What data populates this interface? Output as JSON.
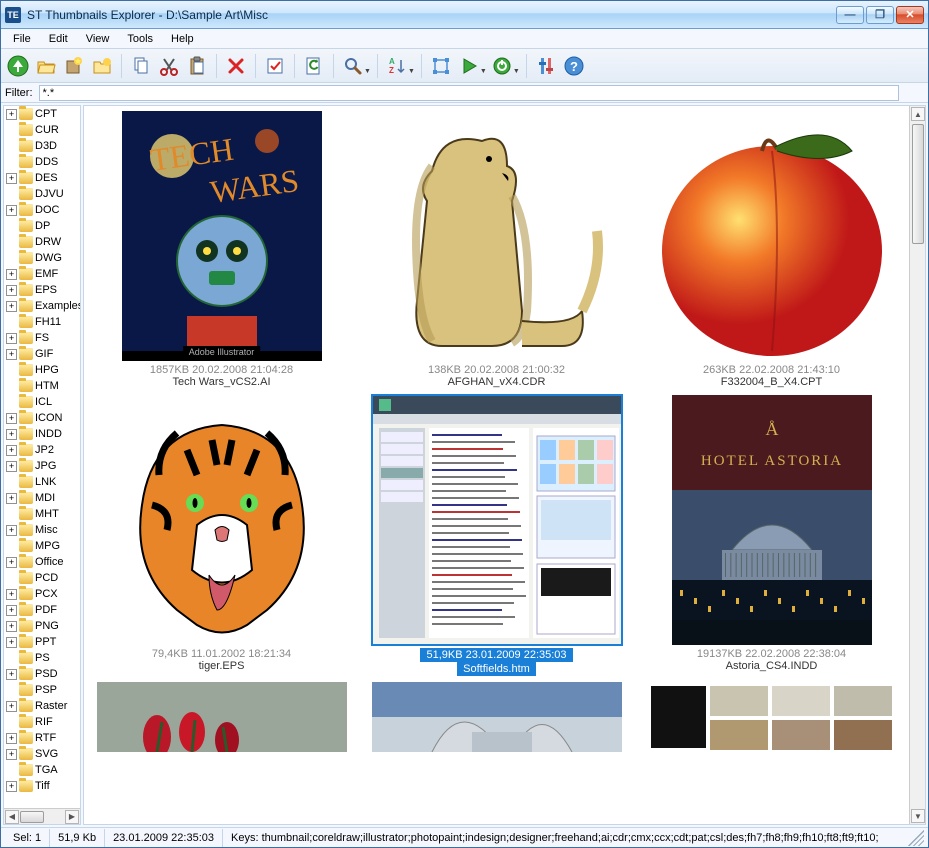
{
  "window": {
    "app_icon_text": "TE",
    "title": "ST Thumbnails Explorer - D:\\Sample Art\\Misc"
  },
  "titlebar_buttons": {
    "minimize_glyph": "—",
    "maximize_glyph": "❐",
    "close_glyph": "✕"
  },
  "menu": {
    "file": "File",
    "edit": "Edit",
    "view": "View",
    "tools": "Tools",
    "help": "Help"
  },
  "filter": {
    "label": "Filter:",
    "value": "*.*"
  },
  "sidebar": {
    "folders": [
      {
        "expand": true,
        "label": "CPT"
      },
      {
        "expand": false,
        "label": "CUR"
      },
      {
        "expand": false,
        "label": "D3D"
      },
      {
        "expand": false,
        "label": "DDS"
      },
      {
        "expand": true,
        "label": "DES"
      },
      {
        "expand": false,
        "label": "DJVU"
      },
      {
        "expand": true,
        "label": "DOC"
      },
      {
        "expand": false,
        "label": "DP"
      },
      {
        "expand": false,
        "label": "DRW"
      },
      {
        "expand": false,
        "label": "DWG"
      },
      {
        "expand": true,
        "label": "EMF"
      },
      {
        "expand": true,
        "label": "EPS"
      },
      {
        "expand": true,
        "label": "Examples"
      },
      {
        "expand": false,
        "label": "FH11"
      },
      {
        "expand": true,
        "label": "FS"
      },
      {
        "expand": true,
        "label": "GIF"
      },
      {
        "expand": false,
        "label": "HPG"
      },
      {
        "expand": false,
        "label": "HTM"
      },
      {
        "expand": false,
        "label": "ICL"
      },
      {
        "expand": true,
        "label": "ICON"
      },
      {
        "expand": true,
        "label": "INDD"
      },
      {
        "expand": true,
        "label": "JP2"
      },
      {
        "expand": true,
        "label": "JPG"
      },
      {
        "expand": false,
        "label": "LNK"
      },
      {
        "expand": true,
        "label": "MDI"
      },
      {
        "expand": false,
        "label": "MHT"
      },
      {
        "expand": true,
        "label": "Misc"
      },
      {
        "expand": false,
        "label": "MPG"
      },
      {
        "expand": true,
        "label": "Office"
      },
      {
        "expand": false,
        "label": "PCD"
      },
      {
        "expand": true,
        "label": "PCX"
      },
      {
        "expand": true,
        "label": "PDF"
      },
      {
        "expand": true,
        "label": "PNG"
      },
      {
        "expand": true,
        "label": "PPT"
      },
      {
        "expand": false,
        "label": "PS"
      },
      {
        "expand": true,
        "label": "PSD"
      },
      {
        "expand": false,
        "label": "PSP"
      },
      {
        "expand": true,
        "label": "Raster"
      },
      {
        "expand": false,
        "label": "RIF"
      },
      {
        "expand": true,
        "label": "RTF"
      },
      {
        "expand": true,
        "label": "SVG"
      },
      {
        "expand": false,
        "label": "TGA"
      },
      {
        "expand": true,
        "label": "Tiff"
      }
    ]
  },
  "thumbnails": [
    {
      "size": "1857KB",
      "date": "20.02.2008 21:04:28",
      "filename": "Tech Wars_vCS2.AI",
      "selected": false,
      "caption": "Adobe Illustrator"
    },
    {
      "size": "138KB",
      "date": "20.02.2008 21:00:32",
      "filename": "AFGHAN_vX4.CDR",
      "selected": false,
      "caption": ""
    },
    {
      "size": "263KB",
      "date": "22.02.2008 21:43:10",
      "filename": "F332004_B_X4.CPT",
      "selected": false,
      "caption": ""
    },
    {
      "size": "79,4KB",
      "date": "11.01.2002 18:21:34",
      "filename": "tiger.EPS",
      "selected": false,
      "caption": ""
    },
    {
      "size": "51,9KB",
      "date": "23.01.2009 22:35:03",
      "filename": "Softfields.htm",
      "selected": true,
      "caption": ""
    },
    {
      "size": "19137KB",
      "date": "22.02.2008 22:38:04",
      "filename": "Astoria_CS4.INDD",
      "selected": false,
      "caption": "HOTEL ASTORIA"
    }
  ],
  "status": {
    "selection": "Sel: 1",
    "size": "51,9 Kb",
    "date": "23.01.2009 22:35:03",
    "keys": "Keys: thumbnail;coreldraw;illustrator;photopaint;indesign;designer;freehand;ai;cdr;cmx;ccx;cdt;pat;csl;des;fh7;fh8;fh9;fh10;ft8;ft9;ft10;"
  },
  "toolbar": {
    "up_tip": "Up",
    "open_tip": "Open",
    "new_tip": "New",
    "folder_tip": "New Folder",
    "copy_tip": "Copy",
    "cut_tip": "Cut",
    "paste_tip": "Paste",
    "delete_tip": "Delete",
    "check_tip": "Select",
    "refresh_tip": "Refresh",
    "zoom_tip": "Zoom",
    "sort_tip": "Sort",
    "crop_tip": "Crop",
    "play_tip": "Slideshow",
    "power_tip": "Power",
    "settings_tip": "Options",
    "help_tip": "Help"
  }
}
